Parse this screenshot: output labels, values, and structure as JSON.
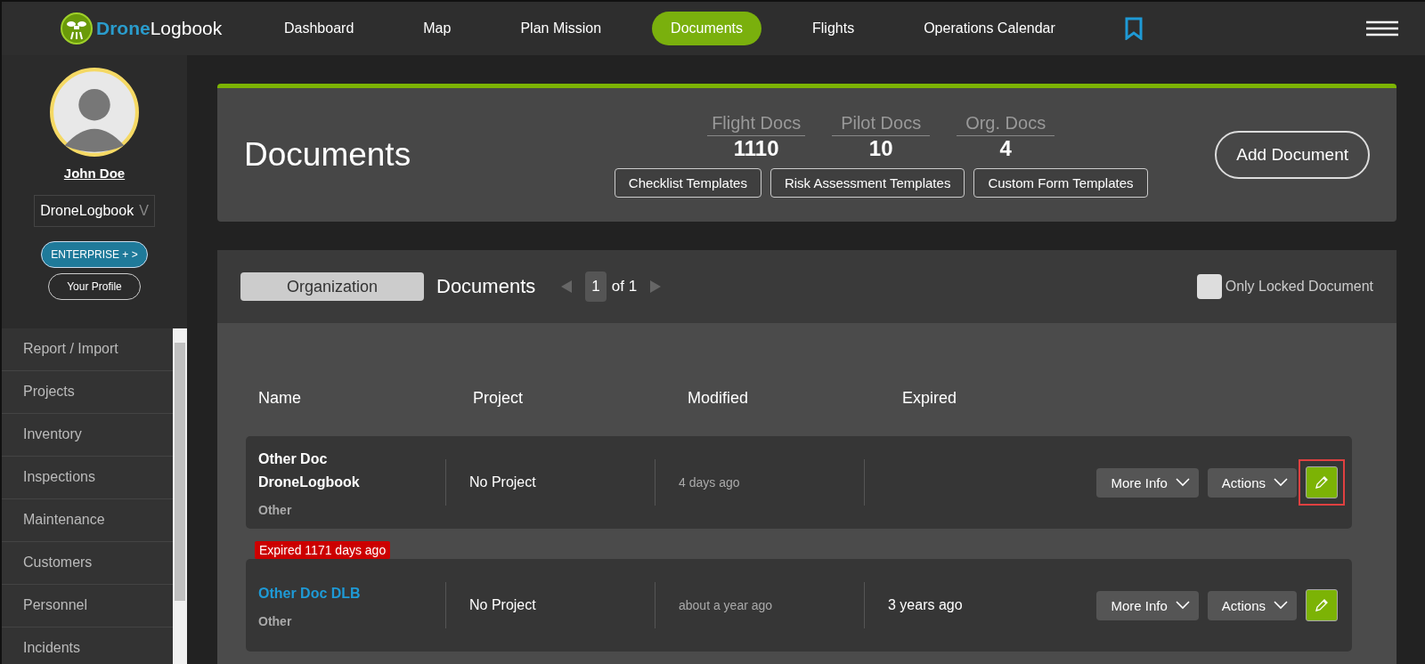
{
  "logo": {
    "part1": "Drone",
    "part2": "Logbook"
  },
  "nav": [
    {
      "label": "Dashboard",
      "selected": false
    },
    {
      "label": "Map",
      "selected": false
    },
    {
      "label": "Plan Mission",
      "selected": false
    },
    {
      "label": "Documents",
      "selected": true
    },
    {
      "label": "Flights",
      "selected": false
    },
    {
      "label": "Operations Calendar",
      "selected": false
    }
  ],
  "user": {
    "name": "John Doe",
    "organization": "DroneLogbook",
    "org_caret": "V",
    "plan": "ENTERPRISE + >",
    "profile": "Your Profile"
  },
  "sidebar": {
    "items": [
      "Report / Import",
      "Projects",
      "Inventory",
      "Inspections",
      "Maintenance",
      "Customers",
      "Personnel",
      "Incidents"
    ]
  },
  "header": {
    "title": "Documents",
    "stats": [
      {
        "label": "Flight Docs",
        "value": "1110"
      },
      {
        "label": "Pilot Docs",
        "value": "10"
      },
      {
        "label": "Org. Docs",
        "value": "4"
      }
    ],
    "templates": [
      "Checklist Templates",
      "Risk Assessment Templates",
      "Custom Form Templates"
    ],
    "add": "Add Document"
  },
  "list": {
    "scope": "Organization",
    "title": "Documents",
    "page": "1",
    "of": "of 1",
    "locked_filter": {
      "label": "Only Locked Document",
      "checked": false
    },
    "columns": [
      "Name",
      "Project",
      "Modified",
      "Expired"
    ],
    "rows": [
      {
        "name": "Other Doc DroneLogbook",
        "link": false,
        "type": "Other",
        "project": "No Project",
        "modified": "4 days ago",
        "expired": null,
        "badge": null,
        "more": "More Info",
        "actions": "Actions",
        "highlighted": true
      },
      {
        "name": "Other Doc DLB",
        "link": true,
        "type": "Other",
        "project": "No Project",
        "modified": "about a year ago",
        "expired": "3 years ago",
        "badge": "Expired 1171 days ago",
        "more": "More Info",
        "actions": "Actions",
        "highlighted": false
      }
    ]
  }
}
